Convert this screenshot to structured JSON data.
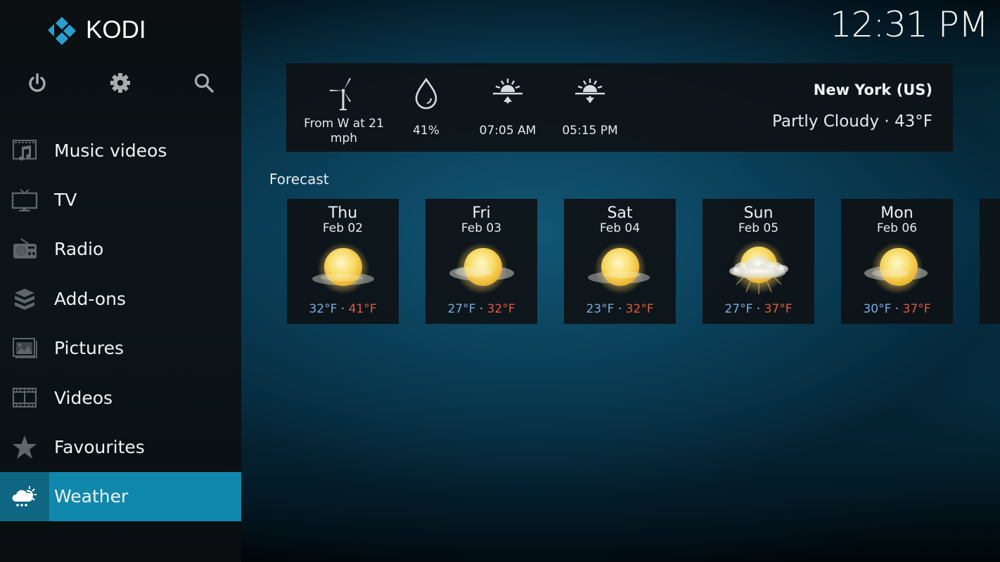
{
  "app": {
    "name": "KODI",
    "accent_color": "#1088ac"
  },
  "clock": "12:31 PM",
  "top_actions": [
    {
      "name": "power",
      "icon": "power-icon"
    },
    {
      "name": "settings",
      "icon": "gear-icon"
    },
    {
      "name": "search",
      "icon": "search-icon"
    }
  ],
  "menu": [
    {
      "label": "Music videos",
      "icon": "music-video-icon",
      "active": false
    },
    {
      "label": "TV",
      "icon": "tv-icon",
      "active": false
    },
    {
      "label": "Radio",
      "icon": "radio-icon",
      "active": false
    },
    {
      "label": "Add-ons",
      "icon": "addons-box-icon",
      "active": false
    },
    {
      "label": "Pictures",
      "icon": "pictures-icon",
      "active": false
    },
    {
      "label": "Videos",
      "icon": "film-strip-icon",
      "active": false
    },
    {
      "label": "Favourites",
      "icon": "star-icon",
      "active": false
    },
    {
      "label": "Weather",
      "icon": "weather-icon",
      "active": true
    }
  ],
  "current": {
    "wind": {
      "icon": "wind-turbine-icon",
      "value": "From W at 21 mph"
    },
    "humidity": {
      "icon": "water-drop-icon",
      "value": "41%"
    },
    "sunrise": {
      "icon": "sunrise-icon",
      "value": "07:05 AM"
    },
    "sunset": {
      "icon": "sunset-icon",
      "value": "05:15 PM"
    },
    "location": "New York (US)",
    "condition": "Partly Cloudy · 43°F"
  },
  "forecast": {
    "title": "Forecast",
    "separator": "·",
    "days": [
      {
        "day": "Thu",
        "date": "Feb 02",
        "low": "32°F",
        "high": "41°F",
        "icon": "mostly-sunny-icon"
      },
      {
        "day": "Fri",
        "date": "Feb 03",
        "low": "27°F",
        "high": "32°F",
        "icon": "mostly-sunny-icon"
      },
      {
        "day": "Sat",
        "date": "Feb 04",
        "low": "23°F",
        "high": "32°F",
        "icon": "mostly-sunny-icon"
      },
      {
        "day": "Sun",
        "date": "Feb 05",
        "low": "27°F",
        "high": "37°F",
        "icon": "partly-cloudy-icon"
      },
      {
        "day": "Mon",
        "date": "Feb 06",
        "low": "30°F",
        "high": "37°F",
        "icon": "mostly-sunny-icon"
      }
    ],
    "colors": {
      "low": "#78aee0",
      "high": "#e05a3a"
    }
  }
}
